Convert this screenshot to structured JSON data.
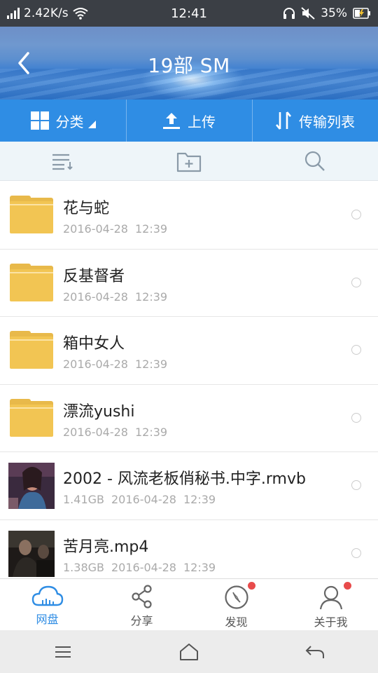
{
  "status_bar": {
    "speed": "2.42K/s",
    "time": "12:41",
    "battery": "35%",
    "icons": [
      "signal-icon",
      "wifi-icon",
      "headphone-icon",
      "mute-icon",
      "battery-charging-icon"
    ]
  },
  "header": {
    "title": "19部 SM",
    "back_icon": "back-chevron-icon"
  },
  "actions": {
    "category": "分类",
    "upload": "上传",
    "transfer_list": "传输列表"
  },
  "toolbar": {
    "icons": [
      "sort-icon",
      "new-folder-icon",
      "search-icon"
    ]
  },
  "files": [
    {
      "type": "folder",
      "name": "花与蛇",
      "size": "",
      "date": "2016-04-28",
      "time": "12:39"
    },
    {
      "type": "folder",
      "name": "反基督者",
      "size": "",
      "date": "2016-04-28",
      "time": "12:39"
    },
    {
      "type": "folder",
      "name": "箱中女人",
      "size": "",
      "date": "2016-04-28",
      "time": "12:39"
    },
    {
      "type": "folder",
      "name": "漂流yushi",
      "size": "",
      "date": "2016-04-28",
      "time": "12:39"
    },
    {
      "type": "video",
      "name": "2002 - 风流老板俏秘书.中字.rmvb",
      "size": "1.41GB",
      "date": "2016-04-28",
      "time": "12:39"
    },
    {
      "type": "video",
      "name": "苦月亮.mp4",
      "size": "1.38GB",
      "date": "2016-04-28",
      "time": "12:39"
    }
  ],
  "bottom_nav": {
    "items": [
      {
        "label": "网盘",
        "icon": "cloud-icon",
        "active": true
      },
      {
        "label": "分享",
        "icon": "share-icon"
      },
      {
        "label": "发现",
        "icon": "compass-icon"
      },
      {
        "label": "关于我",
        "icon": "user-icon"
      }
    ]
  },
  "colors": {
    "primary": "#2f8de4",
    "folder": "#f2c553",
    "badge": "#e84b4b",
    "status_bar": "#3b3f45"
  }
}
